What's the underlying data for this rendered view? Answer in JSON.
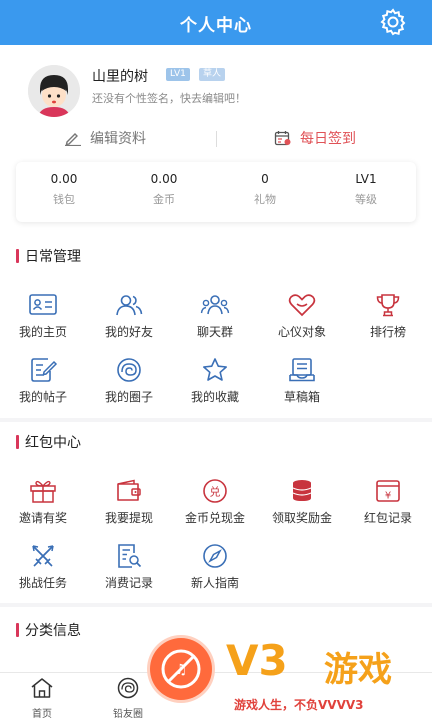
{
  "header": {
    "title": "个人中心"
  },
  "profile": {
    "username": "山里的树",
    "level_badge": "LV1",
    "role_badge": "草人",
    "signature": "还没有个性签名，快去编辑吧！",
    "edit_label": "编辑资料",
    "signin_label": "每日签到"
  },
  "stats": [
    {
      "value": "0.00",
      "label": "钱包"
    },
    {
      "value": "0.00",
      "label": "金币"
    },
    {
      "value": "0",
      "label": "礼物"
    },
    {
      "value": "LV1",
      "label": "等级"
    }
  ],
  "daily": {
    "title": "日常管理",
    "items": [
      {
        "label": "我的主页",
        "icon": "id-card-icon"
      },
      {
        "label": "我的好友",
        "icon": "friends-icon"
      },
      {
        "label": "聊天群",
        "icon": "group-chat-icon"
      },
      {
        "label": "心仪对象",
        "icon": "heart-icon"
      },
      {
        "label": "排行榜",
        "icon": "trophy-icon"
      },
      {
        "label": "我的帖子",
        "icon": "post-icon"
      },
      {
        "label": "我的圈子",
        "icon": "circle-icon"
      },
      {
        "label": "我的收藏",
        "icon": "star-icon"
      },
      {
        "label": "草稿箱",
        "icon": "draft-icon"
      }
    ]
  },
  "redpacket": {
    "title": "红包中心",
    "items": [
      {
        "label": "邀请有奖",
        "icon": "gift-icon"
      },
      {
        "label": "我要提现",
        "icon": "wallet-icon"
      },
      {
        "label": "金币兑现金",
        "icon": "exchange-icon"
      },
      {
        "label": "领取奖励金",
        "icon": "coins-icon"
      },
      {
        "label": "红包记录",
        "icon": "yuan-record-icon"
      },
      {
        "label": "挑战任务",
        "icon": "swords-icon"
      },
      {
        "label": "消费记录",
        "icon": "receipt-search-icon"
      },
      {
        "label": "新人指南",
        "icon": "compass-icon"
      }
    ]
  },
  "category": {
    "title": "分类信息"
  },
  "tabbar": [
    {
      "label": "首页",
      "icon": "home-icon"
    },
    {
      "label": "铅友圈",
      "icon": "circle-tab-icon"
    }
  ],
  "watermark": {
    "brand": "V3",
    "brand_cn": "游戏",
    "slogan": "游戏人生，不负VVVV3"
  },
  "colors": {
    "primary": "#3a99ee",
    "accent": "#d9365a",
    "icon_blue": "#3a6fb6",
    "icon_red": "#c8343e"
  }
}
